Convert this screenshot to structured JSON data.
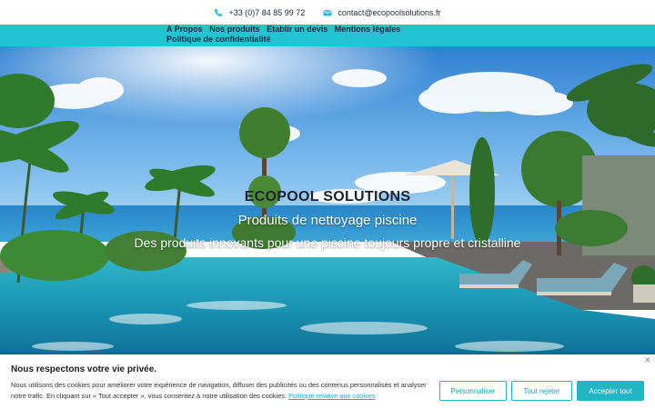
{
  "topbar": {
    "phone": "+33 (0)7 84 85 99 72",
    "email": "contact@ecopoolsolutions.fr",
    "phone_icon": "phone-icon",
    "email_icon": "envelope-icon",
    "icon_color": "#22c4d3"
  },
  "nav": {
    "items": [
      {
        "label": "A Propos"
      },
      {
        "label": "Nos produits"
      },
      {
        "label": "Etablir un devis"
      },
      {
        "label": "Mentions légales"
      },
      {
        "label": "Politique de confidentialité"
      }
    ],
    "background": "#22c4d3"
  },
  "hero": {
    "title": "ECOPOOL SOLUTIONS",
    "subtitle": "Produits de nettoyage piscine",
    "description": "Des produits innovants pour une piscine toujours propre et cristalline"
  },
  "cookie": {
    "title": "Nous respectons votre vie privée.",
    "text": "Nous utilisons des cookies pour améliorer votre expérience de navigation, diffuser des publicités ou des contenus personnalisés et analyser notre trafic. En cliquant sur « Tout accepter », vous consentez à notre utilisation des cookies.",
    "policy_link": "Politique relative aux cookies",
    "buttons": {
      "customize": "Personnaliser",
      "reject": "Tout rejeter",
      "accept": "Accepter tout"
    },
    "close_icon": "close-icon",
    "accent": "#22b5c5"
  }
}
